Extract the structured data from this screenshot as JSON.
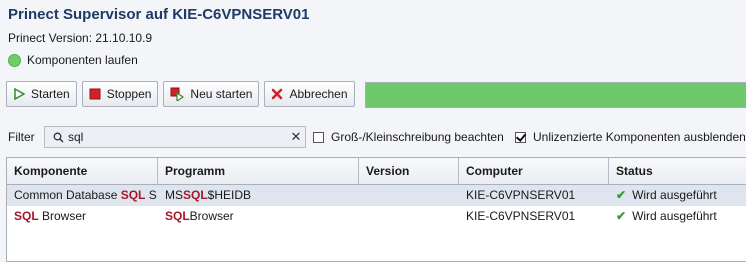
{
  "window": {
    "title": "Prinect Supervisor auf KIE-C6VPNSERV01",
    "version_text": "Prinect Version: 21.10.10.9",
    "state_text": "Komponenten laufen",
    "state_color": "#6ccf6e"
  },
  "toolbar": {
    "start_label": "Starten",
    "stop_label": "Stoppen",
    "restart_label": "Neu starten",
    "cancel_label": "Abbrechen",
    "progress_fraction": 1.0,
    "progress_color": "#6cc86a"
  },
  "filter": {
    "label": "Filter",
    "value": "sql",
    "case_sensitive_label": "Groß-/Kleinschreibung beachten",
    "case_sensitive_checked": false,
    "hide_unlicensed_label": "Unlizenzierte Komponenten ausblenden",
    "hide_unlicensed_checked": true
  },
  "table": {
    "columns": [
      "Komponente",
      "Programm",
      "Version",
      "Computer",
      "Status"
    ],
    "rows": [
      {
        "komponente_pre": "Common Database ",
        "komponente_hl": "SQL",
        "komponente_post": " S",
        "programm_pre": "MS",
        "programm_hl": "SQL",
        "programm_post": "$HEIDB",
        "version": "",
        "computer": "KIE-C6VPNSERV01",
        "status": "Wird ausgeführt",
        "selected": true
      },
      {
        "komponente_pre": "",
        "komponente_hl": "SQL",
        "komponente_post": " Browser",
        "programm_pre": "",
        "programm_hl": "SQL",
        "programm_post": "Browser",
        "version": "",
        "computer": "KIE-C6VPNSERV01",
        "status": "Wird ausgeführt",
        "selected": false
      }
    ]
  },
  "icons": {
    "start": "play-icon",
    "stop": "stop-icon",
    "restart": "restart-icon",
    "cancel": "cancel-x-icon",
    "search": "search-icon",
    "clear": "clear-icon",
    "status_ok": "checkmark-icon"
  }
}
